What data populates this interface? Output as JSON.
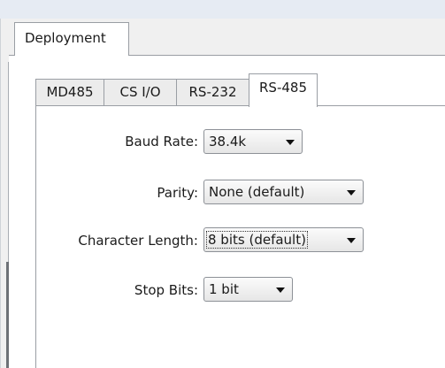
{
  "outer_tab": {
    "label": "Deployment"
  },
  "sub_tabs": [
    {
      "label": "MD485",
      "active": false
    },
    {
      "label": "CS I/O",
      "active": false
    },
    {
      "label": "RS-232",
      "active": false
    },
    {
      "label": "RS-485",
      "active": true
    }
  ],
  "form": {
    "baud_rate": {
      "label": "Baud Rate:",
      "value": "38.4k"
    },
    "parity": {
      "label": "Parity:",
      "value": "None (default)"
    },
    "character_length": {
      "label": "Character Length:",
      "value": "8 bits (default)"
    },
    "stop_bits": {
      "label": "Stop Bits:",
      "value": "1 bit"
    }
  }
}
